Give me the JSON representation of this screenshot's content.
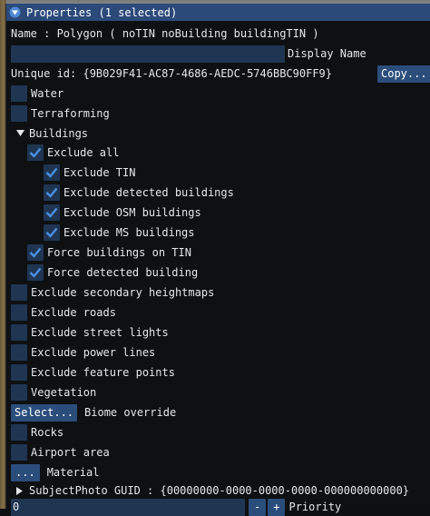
{
  "window": {
    "title": "Properties (1 selected)"
  },
  "header": {
    "name_line": "Name : Polygon  ( noTIN noBuilding buildingTIN )",
    "display_name_value": "",
    "display_name_label": "Display Name",
    "unique_id": "Unique id: {9B029F41-AC87-4686-AEDC-5746BBC90FF9}",
    "copy_button": "Copy..."
  },
  "items": {
    "water": {
      "label": "Water",
      "checked": false
    },
    "terraforming": {
      "label": "Terraforming",
      "checked": false
    },
    "buildings": {
      "label": "Buildings",
      "expanded": true
    },
    "exclude_all": {
      "label": "Exclude all",
      "checked": true
    },
    "exclude_tin": {
      "label": "Exclude TIN",
      "checked": true
    },
    "exclude_detected": {
      "label": "Exclude detected buildings",
      "checked": true
    },
    "exclude_osm": {
      "label": "Exclude OSM buildings",
      "checked": true
    },
    "exclude_ms": {
      "label": "Exclude MS buildings",
      "checked": true
    },
    "force_on_tin": {
      "label": "Force buildings on TIN",
      "checked": true
    },
    "force_detected": {
      "label": "Force detected building",
      "checked": true
    },
    "exclude_secondary": {
      "label": "Exclude secondary heightmaps",
      "checked": false
    },
    "exclude_roads": {
      "label": "Exclude roads",
      "checked": false
    },
    "exclude_lights": {
      "label": "Exclude street lights",
      "checked": false
    },
    "exclude_power": {
      "label": "Exclude power lines",
      "checked": false
    },
    "exclude_features": {
      "label": "Exclude feature points",
      "checked": false
    },
    "vegetation": {
      "label": "Vegetation",
      "checked": false
    },
    "rocks": {
      "label": "Rocks",
      "checked": false
    },
    "airport": {
      "label": "Airport area",
      "checked": false
    }
  },
  "biome": {
    "button": "Select...",
    "label": "Biome override"
  },
  "material": {
    "button": "...",
    "label": "Material"
  },
  "subject_photo": {
    "label": "SubjectPhoto GUID : {00000000-0000-0000-0000-000000000000}",
    "expanded": false
  },
  "priority": {
    "value": "0",
    "minus": "-",
    "plus": "+",
    "label": "Priority"
  },
  "colors": {
    "accent": "#2b4a7a",
    "check": "#4a90e2",
    "frame": "#1f3552"
  }
}
